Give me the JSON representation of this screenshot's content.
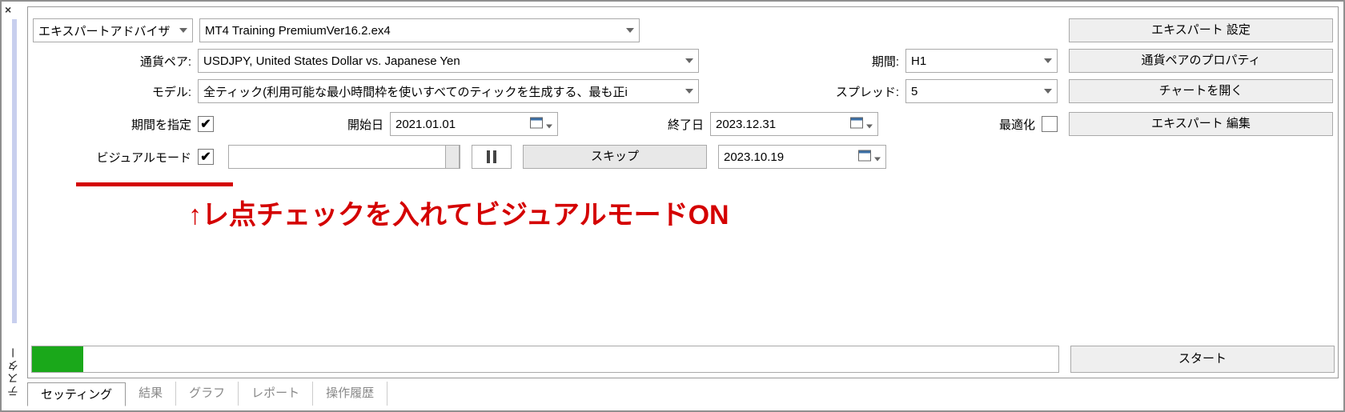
{
  "window": {
    "rail_label": "テスター"
  },
  "labels": {
    "expert": "エキスパートアドバイザ",
    "symbol": "通貨ペア:",
    "model": "モデル:",
    "period": "期間:",
    "spread": "スプレッド:",
    "use_date": "期間を指定",
    "from": "開始日",
    "to": "終了日",
    "optimize": "最適化",
    "visual": "ビジュアルモード"
  },
  "values": {
    "expert": "MT4 Training PremiumVer16.2.ex4",
    "symbol": "USDJPY, United States Dollar vs. Japanese Yen",
    "model": "全ティック(利用可能な最小時間枠を使いすべてのティックを生成する、最も正i",
    "period": "H1",
    "spread": "5",
    "from": "2021.01.01",
    "to": "2023.12.31",
    "visual_date": "2023.10.19"
  },
  "buttons": {
    "expert_properties": "エキスパート 設定",
    "symbol_properties": "通貨ペアのプロパティ",
    "open_chart": "チャートを開く",
    "modify_expert": "エキスパート 編集",
    "skip": "スキップ",
    "start": "スタート"
  },
  "tabs": {
    "settings": "セッティング",
    "results": "結果",
    "graph": "グラフ",
    "report": "レポート",
    "journal": "操作履歴"
  },
  "annotation": "↑レ点チェックを入れてビジュアルモードON"
}
